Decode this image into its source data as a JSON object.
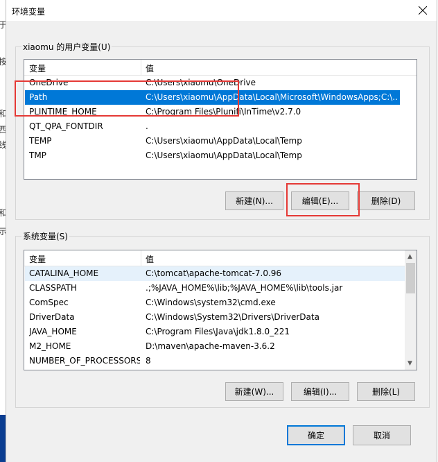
{
  "window": {
    "title": "环境变量"
  },
  "background": {
    "fragments": [
      "于",
      "按",
      "和",
      "西",
      "线",
      "和",
      "示"
    ]
  },
  "user_vars": {
    "legend": "xiaomu 的用户变量(U)",
    "col_var": "变量",
    "col_val": "值",
    "rows": [
      {
        "name": "OneDrive",
        "value": "C:\\Users\\xiaomu\\OneDrive"
      },
      {
        "name": "Path",
        "value": "C:\\Users\\xiaomu\\AppData\\Local\\Microsoft\\WindowsApps;C:\\...",
        "selected": true
      },
      {
        "name": "PLINTIME_HOME",
        "value": "C:\\Program Files\\Plunifi\\InTime\\v2.7.0"
      },
      {
        "name": "QT_QPA_FONTDIR",
        "value": "."
      },
      {
        "name": "TEMP",
        "value": "C:\\Users\\xiaomu\\AppData\\Local\\Temp"
      },
      {
        "name": "TMP",
        "value": "C:\\Users\\xiaomu\\AppData\\Local\\Temp"
      }
    ],
    "buttons": {
      "new": "新建(N)...",
      "edit": "编辑(E)...",
      "delete": "删除(D)"
    }
  },
  "system_vars": {
    "legend": "系统变量(S)",
    "col_var": "变量",
    "col_val": "值",
    "rows": [
      {
        "name": "CATALINA_HOME",
        "value": "C:\\tomcat\\apache-tomcat-7.0.96",
        "highlight": true
      },
      {
        "name": "CLASSPATH",
        "value": ".;%JAVA_HOME%\\lib;%JAVA_HOME%\\lib\\tools.jar"
      },
      {
        "name": "ComSpec",
        "value": "C:\\Windows\\system32\\cmd.exe"
      },
      {
        "name": "DriverData",
        "value": "C:\\Windows\\System32\\Drivers\\DriverData"
      },
      {
        "name": "JAVA_HOME",
        "value": "C:\\Program Files\\Java\\jdk1.8.0_221"
      },
      {
        "name": "M2_HOME",
        "value": "D:\\maven\\apache-maven-3.6.2"
      },
      {
        "name": "NUMBER_OF_PROCESSORS",
        "value": "8"
      }
    ],
    "buttons": {
      "new": "新建(W)...",
      "edit": "编辑(I)...",
      "delete": "删除(L)"
    }
  },
  "footer": {
    "ok": "确定",
    "cancel": "取消"
  },
  "colors": {
    "selection": "#0078d7",
    "annotation": "#e53935",
    "dialog_bg": "#f0f0f0"
  },
  "icons": {
    "close": "close-icon",
    "scroll_up": "scroll-up-icon",
    "scroll_down": "scroll-down-icon"
  }
}
